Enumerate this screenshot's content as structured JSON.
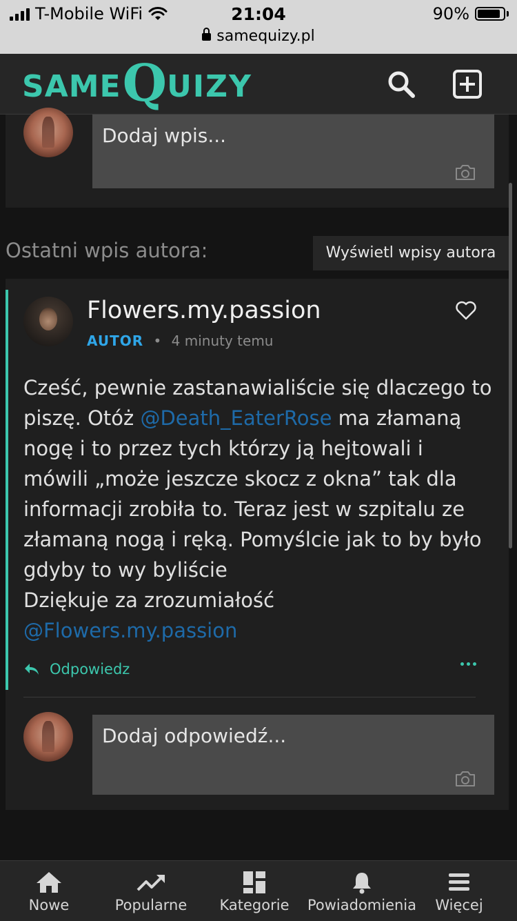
{
  "status_bar": {
    "carrier": "T-Mobile WiFi",
    "time": "21:04",
    "battery": "90%",
    "battery_level": 0.9,
    "url": "samequizy.pl"
  },
  "header": {
    "logo_same": "SAME",
    "logo_q": "Q",
    "logo_uizy": "UIZY",
    "icons": [
      "search-icon",
      "add-square-icon"
    ]
  },
  "compose": {
    "placeholder": "Dodaj wpis..."
  },
  "section": {
    "label": "Ostatni wpis autora:",
    "button": "Wyświetl wpisy autora"
  },
  "post": {
    "author": "Flowers.my.passion",
    "badge": "AUTOR",
    "separator": "•",
    "time": "4 minuty temu",
    "text_1": "Cześć, pewnie zastanawialiście się dlaczego to piszę. Otóż ",
    "mention_1": "@Death_EaterRose",
    "text_2": " ma złamaną nogę i to przez tych którzy ją hejtowali i mówili „może jeszcze skocz z okna” tak dla informacji zrobiła to. Teraz jest w szpitalu ze złamaną nogą i ręką. Pomyślcie jak to by było gdyby to wy byliście",
    "text_3": "Dziękuje za zrozumiałość",
    "mention_2": "@Flowers.my.passion",
    "reply_label": "Odpowiedz"
  },
  "reply_compose": {
    "placeholder": "Dodaj odpowiedź..."
  },
  "tabbar": {
    "items": [
      {
        "label": "Nowe",
        "icon": "home-icon"
      },
      {
        "label": "Popularne",
        "icon": "trending-icon"
      },
      {
        "label": "Kategorie",
        "icon": "categories-icon"
      },
      {
        "label": "Powiadomienia",
        "icon": "bell-icon"
      },
      {
        "label": "Więcej",
        "icon": "menu-icon"
      }
    ]
  },
  "colors": {
    "accent": "#3cc7ad",
    "badge": "#2fa6e8",
    "mention": "#1e6aa8",
    "background": "#141414",
    "card": "#1f1f1f"
  }
}
